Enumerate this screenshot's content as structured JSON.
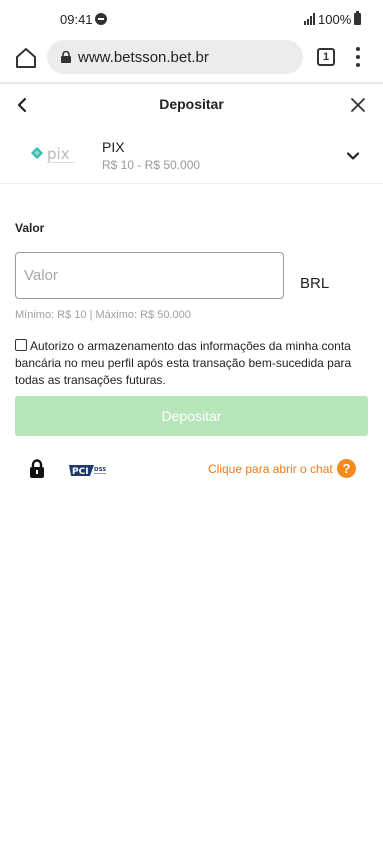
{
  "status_bar": {
    "time": "09:41",
    "battery": "100%"
  },
  "browser": {
    "url": "www.betsson.bet.br",
    "tab_count": "1"
  },
  "header": {
    "title": "Depositar"
  },
  "payment_method": {
    "name": "PIX",
    "range": "R$ 10 - R$ 50.000"
  },
  "form": {
    "value_label": "Valor",
    "amount_placeholder": "Valor",
    "amount_value": "",
    "currency": "BRL",
    "limits": "Mínimo: R$ 10 | Máximo: R$ 50.000",
    "consent_text": "Autorizo o armazenamento das informações da minha conta bancária no meu perfil após esta transação bem-sucedida para todas as transações futuras.",
    "consent_checked": false,
    "submit_label": "Depositar"
  },
  "footer": {
    "chat_label": "Clique para abrir o chat",
    "help_symbol": "?"
  },
  "colors": {
    "accent_orange": "#f07a16",
    "button_green_disabled": "#b5e5b8",
    "pix_teal": "#32bcad"
  }
}
